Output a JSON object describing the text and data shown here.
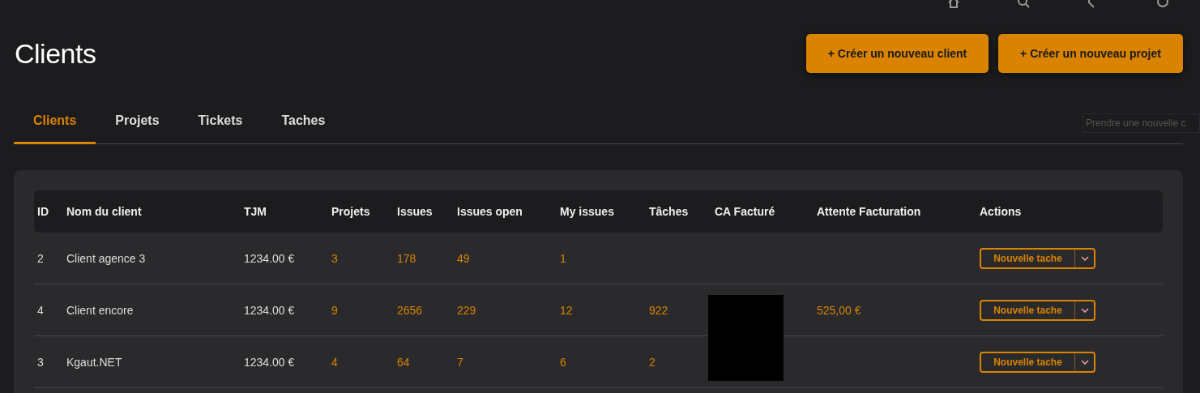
{
  "page": {
    "title": "Clients"
  },
  "header_buttons": [
    "+ Créer un nouveau client",
    "+ Créer un nouveau projet"
  ],
  "tabs": [
    {
      "label": "Clients",
      "selected": true
    },
    {
      "label": "Projets",
      "selected": false
    },
    {
      "label": "Tickets",
      "selected": false
    },
    {
      "label": "Taches",
      "selected": false
    }
  ],
  "quick_field": {
    "placeholder": "Prendre une nouvelle c"
  },
  "table": {
    "columns": [
      "ID",
      "Nom du client",
      "TJM",
      "Projets",
      "Issues",
      "Issues open",
      "My issues",
      "Tâches",
      "CA Facturé",
      "Attente Facturation",
      "Actions"
    ],
    "rows": [
      {
        "id": "2",
        "name": "Client agence 3",
        "tjm": "1234.00 €",
        "projets": "3",
        "issues": "178",
        "issues_open": "49",
        "my_issues": "1",
        "taches": "",
        "ca_redacted": false,
        "attente": "",
        "action": "Nouvelle tache"
      },
      {
        "id": "4",
        "name": "Client encore",
        "tjm": "1234.00 €",
        "projets": "9",
        "issues": "2656",
        "issues_open": "229",
        "my_issues": "12",
        "taches": "922",
        "ca_redacted": true,
        "attente": "525,00 €",
        "action": "Nouvelle tache"
      },
      {
        "id": "3",
        "name": "Kgaut.NET",
        "tjm": "1234.00 €",
        "projets": "4",
        "issues": "64",
        "issues_open": "7",
        "my_issues": "6",
        "taches": "2",
        "ca_redacted": true,
        "attente": "",
        "action": "Nouvelle tache"
      }
    ]
  }
}
